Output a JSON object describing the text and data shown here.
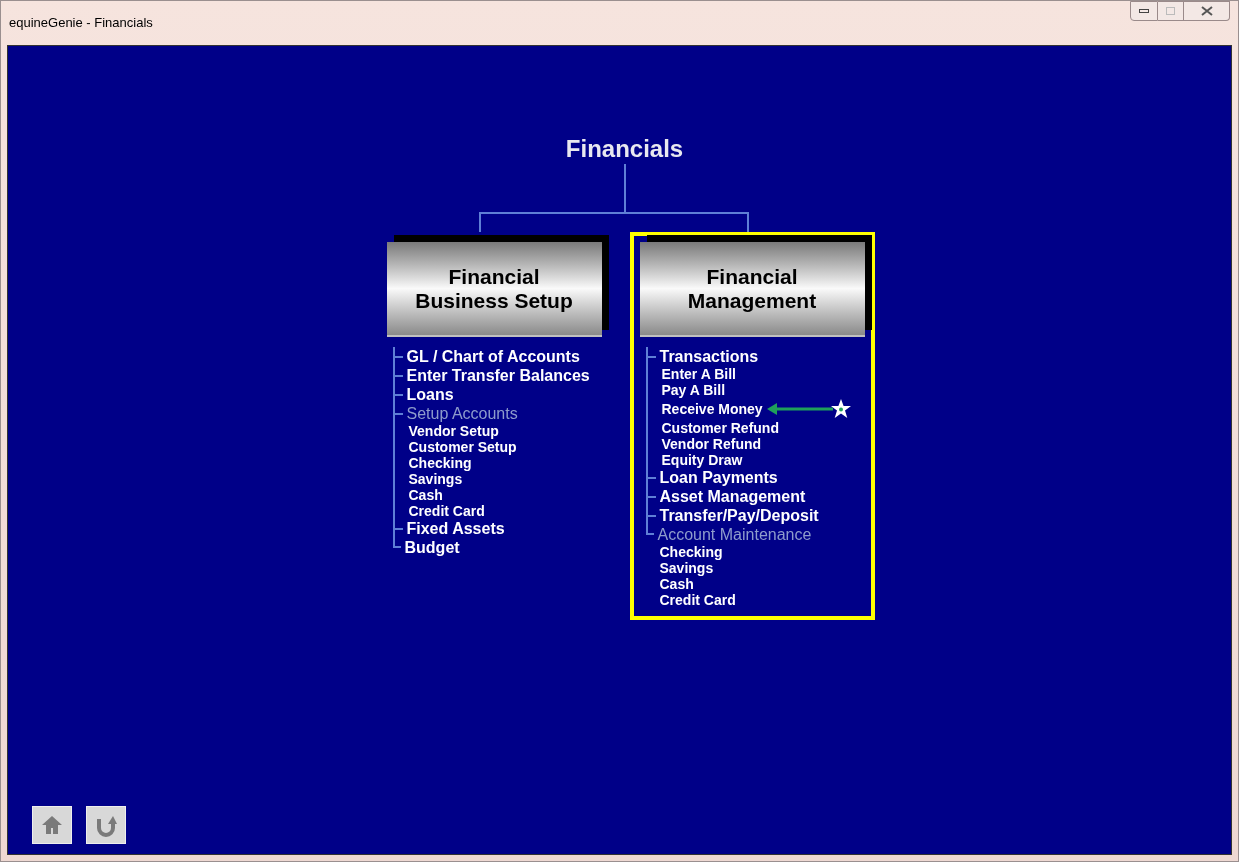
{
  "window": {
    "title": "equineGenie - Financials"
  },
  "heading": "Financials",
  "sections": [
    {
      "title": "Financial Business Setup",
      "highlighted": false,
      "items": [
        {
          "label": "GL / Chart of Accounts",
          "disabled": false
        },
        {
          "label": "Enter Transfer Balances",
          "disabled": false
        },
        {
          "label": "Loans",
          "disabled": false
        },
        {
          "label": "Setup Accounts",
          "disabled": true,
          "children": [
            {
              "label": "Vendor Setup",
              "marked": false
            },
            {
              "label": "Customer Setup",
              "marked": false
            },
            {
              "label": "Checking",
              "marked": false
            },
            {
              "label": "Savings",
              "marked": false
            },
            {
              "label": "Cash",
              "marked": false
            },
            {
              "label": "Credit Card",
              "marked": false
            }
          ]
        },
        {
          "label": "Fixed Assets",
          "disabled": false
        },
        {
          "label": "Budget",
          "disabled": false
        }
      ]
    },
    {
      "title": "Financial Management",
      "highlighted": true,
      "items": [
        {
          "label": "Transactions",
          "disabled": false,
          "children": [
            {
              "label": "Enter A Bill",
              "marked": false
            },
            {
              "label": "Pay A Bill",
              "marked": false
            },
            {
              "label": "Receive Money",
              "marked": true
            },
            {
              "label": "Customer Refund",
              "marked": false
            },
            {
              "label": "Vendor Refund",
              "marked": false
            },
            {
              "label": "Equity Draw",
              "marked": false
            }
          ]
        },
        {
          "label": "Loan Payments",
          "disabled": false
        },
        {
          "label": "Asset Management",
          "disabled": false
        },
        {
          "label": "Transfer/Pay/Deposit",
          "disabled": false
        },
        {
          "label": "Account Maintenance",
          "disabled": true,
          "children": [
            {
              "label": "Checking",
              "marked": false
            },
            {
              "label": "Savings",
              "marked": false
            },
            {
              "label": "Cash",
              "marked": false
            },
            {
              "label": "Credit Card",
              "marked": false
            }
          ]
        }
      ]
    }
  ]
}
